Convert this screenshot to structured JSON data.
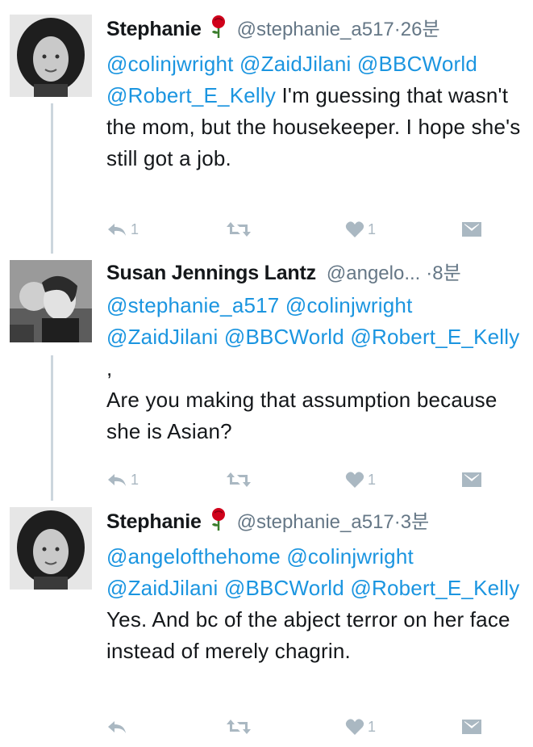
{
  "tweets": [
    {
      "name": "Stephanie",
      "handle": "@stephanie_a517",
      "dot": "·",
      "time": "26분",
      "segments": [
        {
          "t": "@colinjwright",
          "m": true
        },
        {
          "t": " ",
          "m": false
        },
        {
          "t": "@ZaidJilani",
          "m": true
        },
        {
          "t": " ",
          "m": false
        },
        {
          "t": "@BBCWorld",
          "m": true
        },
        {
          "t": " ",
          "m": false
        },
        {
          "t": "@Robert_E_Kelly",
          "m": true
        },
        {
          "t": " I'm guessing that wasn't the mom, but the housekeeper. I hope she's still got a job.",
          "m": false
        }
      ],
      "reply_count": "1",
      "retweet_count": "",
      "like_count": "1"
    },
    {
      "name": "Susan Jennings Lantz",
      "handle": "@angelo...",
      "dot": "·",
      "time": "8분",
      "segments": [
        {
          "t": "@stephanie_a517",
          "m": true
        },
        {
          "t": " ",
          "m": false
        },
        {
          "t": "@colinjwright",
          "m": true
        },
        {
          "t": " ",
          "m": false
        },
        {
          "t": "@ZaidJilani",
          "m": true
        },
        {
          "t": " ",
          "m": false
        },
        {
          "t": "@BBCWorld",
          "m": true
        },
        {
          "t": " ",
          "m": false
        },
        {
          "t": "@Robert_E_Kelly",
          "m": true
        },
        {
          "t": " ,",
          "m": false
        },
        {
          "t": "\n",
          "m": false
        },
        {
          "t": "Are you making that assumption because she is Asian?",
          "m": false
        }
      ],
      "reply_count": "1",
      "retweet_count": "",
      "like_count": "1"
    },
    {
      "name": "Stephanie",
      "handle": "@stephanie_a517",
      "dot": "·",
      "time": "3분",
      "segments": [
        {
          "t": "@angelofthehome",
          "m": true
        },
        {
          "t": " ",
          "m": false
        },
        {
          "t": "@colinjwright",
          "m": true
        },
        {
          "t": " ",
          "m": false
        },
        {
          "t": "@ZaidJilani",
          "m": true
        },
        {
          "t": " ",
          "m": false
        },
        {
          "t": "@BBCWorld",
          "m": true
        },
        {
          "t": " ",
          "m": false
        },
        {
          "t": "@Robert_E_Kelly",
          "m": true
        },
        {
          "t": " Yes. And bc of the abject terror on her face instead of merely chagrin.",
          "m": false
        }
      ],
      "reply_count": "",
      "retweet_count": "",
      "like_count": "1"
    }
  ],
  "colors": {
    "mention": "#1b95e0",
    "meta": "#657786",
    "action": "#aab8c2",
    "rose": "#d0021b"
  },
  "icons": [
    "rose-emoji-icon",
    "reply-icon",
    "retweet-icon",
    "like-icon",
    "direct-message-icon"
  ]
}
